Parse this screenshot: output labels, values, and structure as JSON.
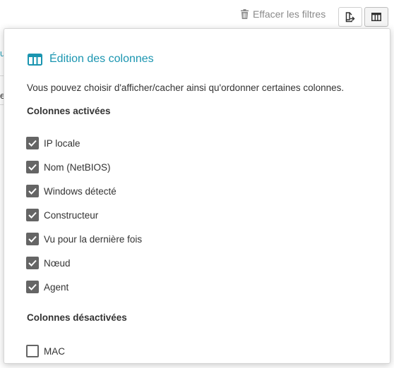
{
  "toolbar": {
    "clear_filters_label": "Effacer les filtres"
  },
  "background": {
    "edge_text_1": "u",
    "edge_text_2": "e"
  },
  "popover": {
    "title": "Édition des colonnes",
    "description": "Vous pouvez choisir d'afficher/cacher ainsi qu'ordonner certaines colonnes.",
    "active_section_title": "Colonnes activées",
    "inactive_section_title": "Colonnes désactivées",
    "active_columns": [
      {
        "label": "IP locale",
        "checked": true
      },
      {
        "label": "Nom (NetBIOS)",
        "checked": true
      },
      {
        "label": "Windows détecté",
        "checked": true
      },
      {
        "label": "Constructeur",
        "checked": true
      },
      {
        "label": "Vu pour la dernière fois",
        "checked": true
      },
      {
        "label": "Nœud",
        "checked": true
      },
      {
        "label": "Agent",
        "checked": true
      }
    ],
    "inactive_columns": [
      {
        "label": "MAC",
        "checked": false
      }
    ]
  },
  "colors": {
    "accent": "#1a95b0",
    "checkbox": "#656565"
  },
  "icons": {
    "clear_filters": "trash-icon",
    "export": "file-export-icon",
    "columns": "columns-icon",
    "header": "columns-icon"
  }
}
